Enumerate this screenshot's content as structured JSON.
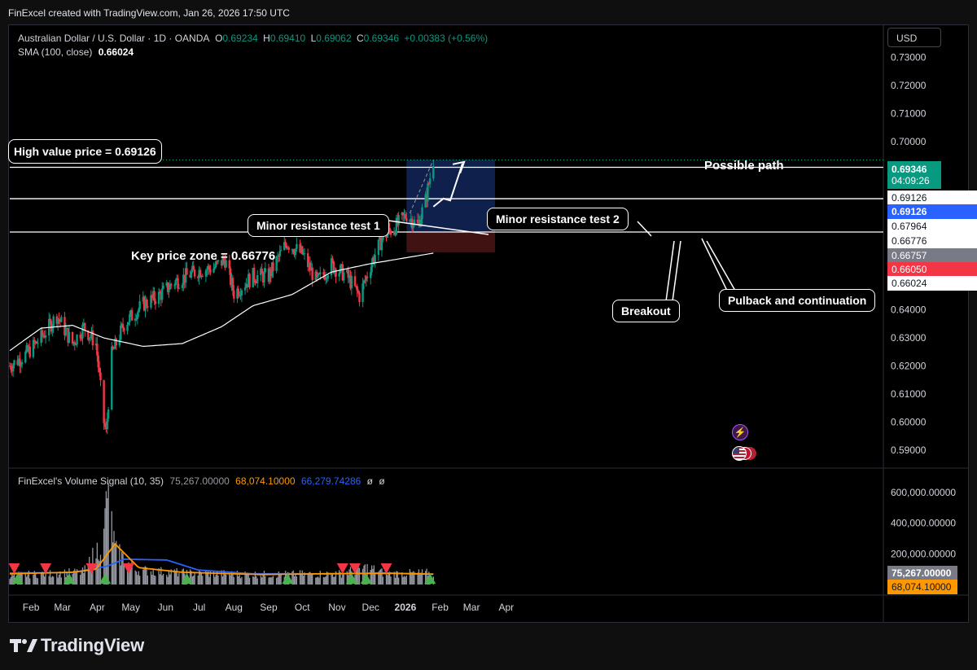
{
  "header": {
    "attribution": "FinExcel created with TradingView.com, Jan 26, 2026 17:50 UTC"
  },
  "symbol": {
    "title": "Australian Dollar / U.S. Dollar · 1D · OANDA",
    "o_label": "O",
    "o": "0.69234",
    "h_label": "H",
    "h": "0.69410",
    "l_label": "L",
    "l": "0.69062",
    "c_label": "C",
    "c": "0.69346",
    "change": "+0.00383 (+0.56%)",
    "sma_label": "SMA (100, close)",
    "sma_value": "0.66024"
  },
  "currency_button": "USD",
  "volume_legend": {
    "name": "FinExcel's Volume Signal (10, 35)",
    "v1": "75,267.00000",
    "v2": "68,074.10000",
    "v3": "66,279.74286",
    "v4": "ø",
    "v5": "ø"
  },
  "annotations": {
    "high_value": "High value price = 0.69126",
    "key_zone": "Key price zone = 0.66776",
    "minor1": "Minor resistance test 1",
    "minor2": "Minor resistance test 2",
    "possible_path": "Possible path",
    "breakout": "Breakout",
    "pullback": "Pulback and continuation"
  },
  "price_labels": {
    "last": "0.69346",
    "countdown": "04:09:26",
    "l1": "0.69126",
    "l2": "0.69126",
    "l3": "0.67964",
    "l4": "0.66776",
    "l5": "0.66757",
    "l6": "0.66050",
    "l7": "0.66024"
  },
  "volume_labels": {
    "a": "75,267.00000",
    "b": "68,074.10000"
  },
  "logo": {
    "text": "TradingView"
  },
  "colors": {
    "up": "#089981",
    "down": "#f23645",
    "sma": "#ffffff",
    "vol_orange": "#ff9800",
    "vol_blue": "#2962ff",
    "target_zone": "#1e3a8a",
    "stop_zone": "#5c1a1a"
  },
  "chart_data": [
    {
      "type": "candlestick",
      "title": "Australian Dollar / U.S. Dollar · 1D · OANDA",
      "x_ticks": [
        "Feb",
        "Mar",
        "Apr",
        "May",
        "Jun",
        "Jul",
        "Aug",
        "Sep",
        "Oct",
        "Nov",
        "Dec",
        "2026",
        "Feb",
        "Mar",
        "Apr"
      ],
      "y_ticks": [
        "0.73000",
        "0.72000",
        "0.71000",
        "0.70000",
        "0.69000",
        "0.68000",
        "0.67000",
        "0.66000",
        "0.65000",
        "0.64000",
        "0.63000",
        "0.62000",
        "0.61000",
        "0.60000",
        "0.59000"
      ],
      "ylim": [
        0.5865,
        0.738
      ],
      "anchors": [
        [
          "2025-01-13",
          0.62
        ],
        [
          "2025-01-27",
          0.624
        ],
        [
          "2025-02-10",
          0.63
        ],
        [
          "2025-02-24",
          0.638
        ],
        [
          "2025-03-10",
          0.628
        ],
        [
          "2025-03-20",
          0.634
        ],
        [
          "2025-03-31",
          0.628
        ],
        [
          "2025-04-07",
          0.6
        ],
        [
          "2025-04-09",
          0.596
        ],
        [
          "2025-04-14",
          0.624
        ],
        [
          "2025-04-25",
          0.635
        ],
        [
          "2025-05-12",
          0.642
        ],
        [
          "2025-05-26",
          0.645
        ],
        [
          "2025-06-09",
          0.65
        ],
        [
          "2025-06-30",
          0.654
        ],
        [
          "2025-07-14",
          0.655
        ],
        [
          "2025-07-24",
          0.658
        ],
        [
          "2025-08-01",
          0.646
        ],
        [
          "2025-08-18",
          0.652
        ],
        [
          "2025-09-01",
          0.652
        ],
        [
          "2025-09-17",
          0.664
        ],
        [
          "2025-10-01",
          0.66
        ],
        [
          "2025-10-14",
          0.65
        ],
        [
          "2025-10-27",
          0.656
        ],
        [
          "2025-11-10",
          0.652
        ],
        [
          "2025-11-21",
          0.645
        ],
        [
          "2025-12-03",
          0.658
        ],
        [
          "2025-12-12",
          0.666
        ],
        [
          "2025-12-24",
          0.67
        ],
        [
          "2026-01-02",
          0.674
        ],
        [
          "2026-01-12",
          0.67
        ],
        [
          "2026-01-19",
          0.679
        ],
        [
          "2026-01-26",
          0.69346
        ]
      ],
      "sma_anchors": [
        [
          "2025-01-13",
          0.6255
        ],
        [
          "2025-02-10",
          0.6335
        ],
        [
          "2025-03-10",
          0.6345
        ],
        [
          "2025-04-07",
          0.63
        ],
        [
          "2025-05-12",
          0.627
        ],
        [
          "2025-06-16",
          0.628
        ],
        [
          "2025-07-21",
          0.634
        ],
        [
          "2025-08-18",
          0.6415
        ],
        [
          "2025-09-22",
          0.6455
        ],
        [
          "2025-10-27",
          0.6535
        ],
        [
          "2025-12-01",
          0.6565
        ],
        [
          "2025-12-31",
          0.6585
        ],
        [
          "2026-01-26",
          0.66024
        ]
      ],
      "horizontal_levels": [
        0.69346,
        0.69126,
        0.67964,
        0.66776
      ],
      "position": {
        "entry": 0.66776,
        "target": 0.69346,
        "stop": 0.6605,
        "start": "2026-01-02",
        "end": "2026-03-22"
      },
      "projected_path": [
        [
          "2026-01-26",
          0.6768
        ],
        [
          "2026-02-04",
          0.6797
        ],
        [
          "2026-02-10",
          0.679
        ],
        [
          "2026-02-21",
          0.6922
        ]
      ]
    },
    {
      "type": "bar",
      "title": "FinExcel's Volume Signal (10, 35)",
      "y_ticks": [
        "600,000.00000",
        "400,000.00000",
        "200,000.00000"
      ],
      "ylim": [
        0,
        680000
      ],
      "volume_anchors": [
        [
          "2025-01-13",
          60000
        ],
        [
          "2025-03-20",
          80000
        ],
        [
          "2025-04-07",
          300000
        ],
        [
          "2025-04-10",
          640000
        ],
        [
          "2025-04-17",
          220000
        ],
        [
          "2025-05-05",
          95000
        ],
        [
          "2025-06-16",
          75000
        ],
        [
          "2025-08-25",
          65000
        ],
        [
          "2025-11-03",
          70000
        ],
        [
          "2025-11-28",
          110000
        ],
        [
          "2025-12-15",
          70000
        ],
        [
          "2026-01-26",
          75267
        ]
      ],
      "orange_line": [
        [
          "2025-01-13",
          70000
        ],
        [
          "2025-03-10",
          80000
        ],
        [
          "2025-03-31",
          100000
        ],
        [
          "2025-04-17",
          265000
        ],
        [
          "2025-05-08",
          110000
        ],
        [
          "2025-06-16",
          80000
        ],
        [
          "2025-08-25",
          65000
        ],
        [
          "2025-11-10",
          72000
        ],
        [
          "2025-12-15",
          73000
        ],
        [
          "2026-01-26",
          68074.1
        ]
      ],
      "blue_line": [
        [
          "2025-01-13",
          75000
        ],
        [
          "2025-03-10",
          78000
        ],
        [
          "2025-04-10",
          120000
        ],
        [
          "2025-04-25",
          165000
        ],
        [
          "2025-06-02",
          160000
        ],
        [
          "2025-06-30",
          95000
        ],
        [
          "2025-08-18",
          70000
        ],
        [
          "2025-11-03",
          70000
        ],
        [
          "2025-12-15",
          76000
        ],
        [
          "2026-01-26",
          66279.74
        ]
      ],
      "signals_up": [
        "2025-01-20",
        "2025-03-07",
        "2025-04-08",
        "2025-06-20",
        "2025-09-18",
        "2025-11-14",
        "2025-11-27",
        "2026-01-23"
      ],
      "signals_down": [
        "2025-01-17",
        "2025-02-14",
        "2025-03-27",
        "2025-04-29",
        "2025-11-06",
        "2025-11-17",
        "2025-12-15"
      ]
    }
  ]
}
